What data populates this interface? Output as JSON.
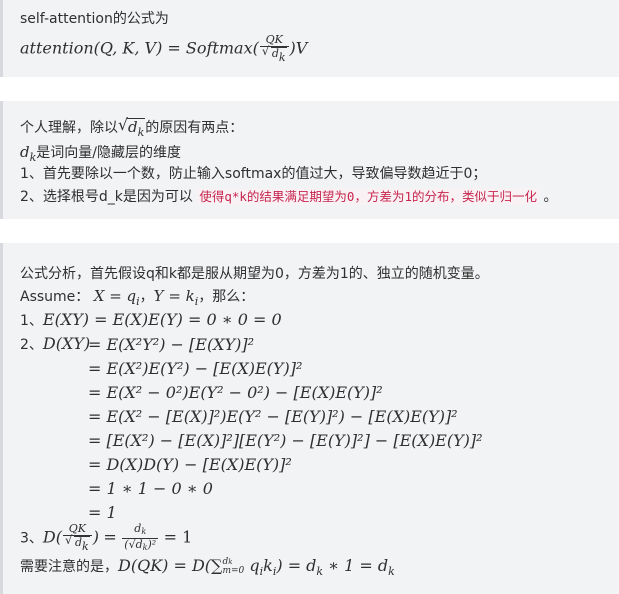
{
  "block1": {
    "heading": "self-attention的公式为",
    "formula": {
      "lhs": "attention(Q, K, V)",
      "equals": "=",
      "fn": "Softmax(",
      "frac_num": "QK",
      "frac_den_sym": "d",
      "frac_den_sub": "k",
      "tail": ")V"
    }
  },
  "block2": {
    "l1_pre": "个人理解，除以",
    "l1_sym": "d",
    "l1_sub": "k",
    "l1_post": "的原因有两点：",
    "l2_sym": "d",
    "l2_sub": "k",
    "l2_post": "是词向量/隐藏层的维度",
    "l3": "1、首先要除以一个数，防止输入softmax的值过大，导致偏导数趋近于0；",
    "l4_pre": "2、选择根号d_k是因为可以",
    "l4_highlight": "使得q*k的结果满足期望为0，方差为1的分布，类似于归一化",
    "l4_post": "。"
  },
  "block3": {
    "intro": "公式分析，首先假设q和k都是服从期望为0，方差为1的、独立的随机变量。",
    "assume_label": "Assume：",
    "assume_x": "X = q",
    "assume_x_sub": "i",
    "assume_y": "Y = k",
    "assume_y_sub": "i",
    "assume_post": "，那么：",
    "item1_label": "1、",
    "item1_eq": "E(XY) = E(X)E(Y) = 0 ∗ 0 = 0",
    "item2_label": "2、",
    "item2_lhs": "D(XY)",
    "item2_rows": [
      "= E(X²Y²) − [E(XY)]²",
      "= E(X²)E(Y²) − [E(X)E(Y)]²",
      "= E(X² − 0²)E(Y² − 0²) − [E(X)E(Y)]²",
      "= E(X² − [E(X)]²)E(Y² − [E(Y)]²) − [E(X)E(Y)]²",
      "= [E(X²) − [E(X)]²][E(Y²) − [E(Y)]²] − [E(X)E(Y)]²",
      "= D(X)D(Y) − [E(X)E(Y)]²",
      "= 1 ∗ 1 − 0 ∗ 0",
      "= 1"
    ],
    "item3_label": "3、",
    "item3_D": "D(",
    "item3_num": "QK",
    "item3_den": "d",
    "item3_den_sub": "k",
    "item3_close": ")",
    "item3_eq": "=",
    "item3_frac2_num": "d",
    "item3_frac2_num_sub": "k",
    "item3_frac2_den": "(√d",
    "item3_frac2_den_sub": "k",
    "item3_frac2_den_tail": ")²",
    "item3_result": "= 1",
    "note_label": "需要注意的是，",
    "note_eq_pre": "D(QK) = D(∑",
    "note_sum_upper": "d",
    "note_sum_upper_sub": "k",
    "note_sum_lower": "m=0",
    "note_eq_body": " q",
    "note_q_sub": "i",
    "note_k": "k",
    "note_k_sub": "i",
    "note_eq_post": ") = d",
    "note_dk_sub": "k",
    "note_eq_tail": " ∗ 1 = d",
    "note_dk2_sub": "k"
  }
}
